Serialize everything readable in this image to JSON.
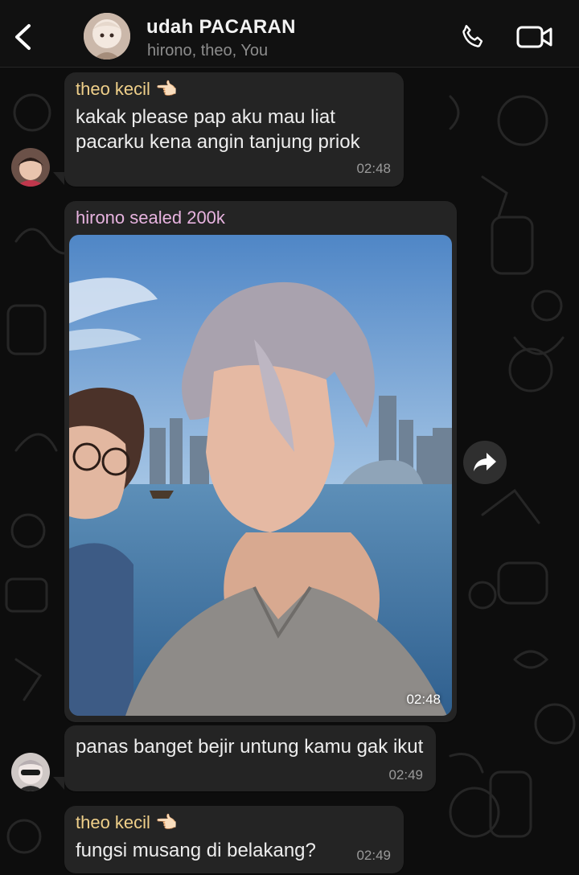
{
  "header": {
    "title": "udah PACARAN",
    "subtitle": "hirono, theo, You"
  },
  "messages": [
    {
      "sender": "theo kecil 👈🏻",
      "text": "kakak please pap aku mau liat pacarku kena angin tanjung priok",
      "time": "02:48"
    },
    {
      "sender": "hirono sealed 200k",
      "text": "",
      "time": "02:48",
      "type": "image"
    },
    {
      "sender": "",
      "text": "panas banget bejir untung kamu gak ikut",
      "time": "02:49"
    },
    {
      "sender": "theo kecil 👈🏻",
      "text": "fungsi musang di belakang?",
      "time": "02:49"
    }
  ],
  "colors": {
    "background": "#0d0d0d",
    "bubble": "#242424",
    "sender_theo": "#f0d08a",
    "sender_hirono": "#e7b3df",
    "timestamp": "#9a9a9a"
  },
  "icons": [
    "back-chevron-icon",
    "phone-icon",
    "video-camera-icon",
    "forward-icon"
  ]
}
